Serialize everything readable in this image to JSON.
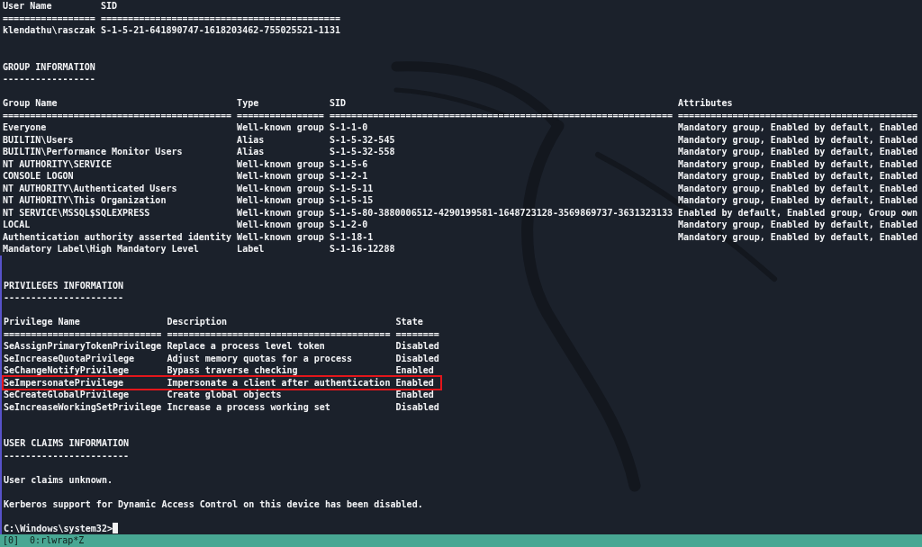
{
  "user_information": {
    "columns": [
      {
        "heading": "User Name",
        "rule": "================="
      },
      {
        "heading": "SID",
        "rule": "============================================"
      }
    ],
    "rows": [
      {
        "cells": [
          "klendathu\\rasczak",
          "S-1-5-21-641890747-1618203462-755025521-1131"
        ]
      }
    ]
  },
  "group_information": {
    "title": "GROUP INFORMATION",
    "underline": "-----------------",
    "columns": [
      {
        "heading": "Group Name",
        "rule": "=========================================="
      },
      {
        "heading": "Type",
        "rule": "================"
      },
      {
        "heading": "SID",
        "rule": "==============================================================="
      },
      {
        "heading": "Attributes",
        "rule": "============================================"
      }
    ],
    "rows": [
      {
        "cells": [
          "Everyone",
          "Well-known group",
          "S-1-1-0",
          "Mandatory group, Enabled by default, Enabled"
        ]
      },
      {
        "cells": [
          "BUILTIN\\Users",
          "Alias",
          "S-1-5-32-545",
          "Mandatory group, Enabled by default, Enabled"
        ]
      },
      {
        "cells": [
          "BUILTIN\\Performance Monitor Users",
          "Alias",
          "S-1-5-32-558",
          "Mandatory group, Enabled by default, Enabled"
        ]
      },
      {
        "cells": [
          "NT AUTHORITY\\SERVICE",
          "Well-known group",
          "S-1-5-6",
          "Mandatory group, Enabled by default, Enabled"
        ]
      },
      {
        "cells": [
          "CONSOLE LOGON",
          "Well-known group",
          "S-1-2-1",
          "Mandatory group, Enabled by default, Enabled"
        ]
      },
      {
        "cells": [
          "NT AUTHORITY\\Authenticated Users",
          "Well-known group",
          "S-1-5-11",
          "Mandatory group, Enabled by default, Enabled"
        ]
      },
      {
        "cells": [
          "NT AUTHORITY\\This Organization",
          "Well-known group",
          "S-1-5-15",
          "Mandatory group, Enabled by default, Enabled"
        ]
      },
      {
        "cells": [
          "NT SERVICE\\MSSQL$SQLEXPRESS",
          "Well-known group",
          "S-1-5-80-3880006512-4290199581-1648723128-3569869737-3631323133",
          "Enabled by default, Enabled group, Group own"
        ]
      },
      {
        "cells": [
          "LOCAL",
          "Well-known group",
          "S-1-2-0",
          "Mandatory group, Enabled by default, Enabled"
        ]
      },
      {
        "cells": [
          "Authentication authority asserted identity",
          "Well-known group",
          "S-1-18-1",
          "Mandatory group, Enabled by default, Enabled"
        ]
      },
      {
        "cells": [
          "Mandatory Label\\High Mandatory Level",
          "Label",
          "S-1-16-12288"
        ]
      }
    ]
  },
  "privileges_information": {
    "title": "PRIVILEGES INFORMATION",
    "underline": "----------------------",
    "columns": [
      {
        "heading": "Privilege Name",
        "rule": "============================="
      },
      {
        "heading": "Description",
        "rule": "========================================="
      },
      {
        "heading": "State",
        "rule": "========"
      }
    ],
    "rows": [
      {
        "cells": [
          "SeAssignPrimaryTokenPrivilege",
          "Replace a process level token",
          "Disabled"
        ],
        "highlighted": false
      },
      {
        "cells": [
          "SeIncreaseQuotaPrivilege",
          "Adjust memory quotas for a process",
          "Disabled"
        ],
        "highlighted": false
      },
      {
        "cells": [
          "SeChangeNotifyPrivilege",
          "Bypass traverse checking",
          "Enabled"
        ],
        "highlighted": false
      },
      {
        "cells": [
          "SeImpersonatePrivilege",
          "Impersonate a client after authentication",
          "Enabled"
        ],
        "highlighted": true
      },
      {
        "cells": [
          "SeCreateGlobalPrivilege",
          "Create global objects",
          "Enabled"
        ],
        "highlighted": false
      },
      {
        "cells": [
          "SeIncreaseWorkingSetPrivilege",
          "Increase a process working set",
          "Disabled"
        ],
        "highlighted": false
      }
    ]
  },
  "user_claims_information": {
    "title": "USER CLAIMS INFORMATION",
    "underline": "-----------------------",
    "messages": [
      "User claims unknown.",
      "Kerberos support for Dynamic Access Control on this device has been disabled."
    ]
  },
  "prompt": {
    "text": "C:\\Windows\\system32>",
    "cursor": true
  },
  "status_bar": {
    "session": "[0]",
    "windows": [
      "0:rlwrap*Z"
    ]
  }
}
